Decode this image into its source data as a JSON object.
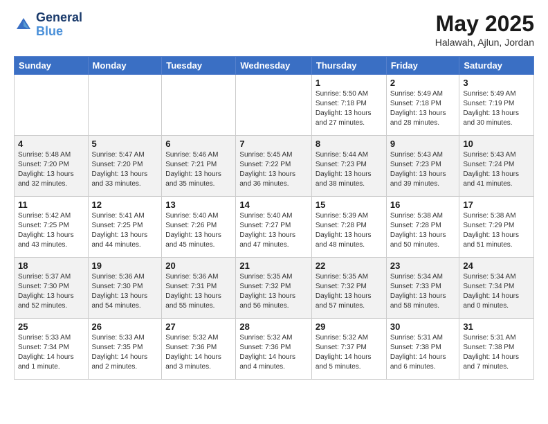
{
  "header": {
    "logo_line1": "General",
    "logo_line2": "Blue",
    "month": "May 2025",
    "location": "Halawah, Ajlun, Jordan"
  },
  "days_of_week": [
    "Sunday",
    "Monday",
    "Tuesday",
    "Wednesday",
    "Thursday",
    "Friday",
    "Saturday"
  ],
  "weeks": [
    [
      {
        "day": "",
        "info": ""
      },
      {
        "day": "",
        "info": ""
      },
      {
        "day": "",
        "info": ""
      },
      {
        "day": "",
        "info": ""
      },
      {
        "day": "1",
        "info": "Sunrise: 5:50 AM\nSunset: 7:18 PM\nDaylight: 13 hours\nand 27 minutes."
      },
      {
        "day": "2",
        "info": "Sunrise: 5:49 AM\nSunset: 7:18 PM\nDaylight: 13 hours\nand 28 minutes."
      },
      {
        "day": "3",
        "info": "Sunrise: 5:49 AM\nSunset: 7:19 PM\nDaylight: 13 hours\nand 30 minutes."
      }
    ],
    [
      {
        "day": "4",
        "info": "Sunrise: 5:48 AM\nSunset: 7:20 PM\nDaylight: 13 hours\nand 32 minutes."
      },
      {
        "day": "5",
        "info": "Sunrise: 5:47 AM\nSunset: 7:20 PM\nDaylight: 13 hours\nand 33 minutes."
      },
      {
        "day": "6",
        "info": "Sunrise: 5:46 AM\nSunset: 7:21 PM\nDaylight: 13 hours\nand 35 minutes."
      },
      {
        "day": "7",
        "info": "Sunrise: 5:45 AM\nSunset: 7:22 PM\nDaylight: 13 hours\nand 36 minutes."
      },
      {
        "day": "8",
        "info": "Sunrise: 5:44 AM\nSunset: 7:23 PM\nDaylight: 13 hours\nand 38 minutes."
      },
      {
        "day": "9",
        "info": "Sunrise: 5:43 AM\nSunset: 7:23 PM\nDaylight: 13 hours\nand 39 minutes."
      },
      {
        "day": "10",
        "info": "Sunrise: 5:43 AM\nSunset: 7:24 PM\nDaylight: 13 hours\nand 41 minutes."
      }
    ],
    [
      {
        "day": "11",
        "info": "Sunrise: 5:42 AM\nSunset: 7:25 PM\nDaylight: 13 hours\nand 43 minutes."
      },
      {
        "day": "12",
        "info": "Sunrise: 5:41 AM\nSunset: 7:25 PM\nDaylight: 13 hours\nand 44 minutes."
      },
      {
        "day": "13",
        "info": "Sunrise: 5:40 AM\nSunset: 7:26 PM\nDaylight: 13 hours\nand 45 minutes."
      },
      {
        "day": "14",
        "info": "Sunrise: 5:40 AM\nSunset: 7:27 PM\nDaylight: 13 hours\nand 47 minutes."
      },
      {
        "day": "15",
        "info": "Sunrise: 5:39 AM\nSunset: 7:28 PM\nDaylight: 13 hours\nand 48 minutes."
      },
      {
        "day": "16",
        "info": "Sunrise: 5:38 AM\nSunset: 7:28 PM\nDaylight: 13 hours\nand 50 minutes."
      },
      {
        "day": "17",
        "info": "Sunrise: 5:38 AM\nSunset: 7:29 PM\nDaylight: 13 hours\nand 51 minutes."
      }
    ],
    [
      {
        "day": "18",
        "info": "Sunrise: 5:37 AM\nSunset: 7:30 PM\nDaylight: 13 hours\nand 52 minutes."
      },
      {
        "day": "19",
        "info": "Sunrise: 5:36 AM\nSunset: 7:30 PM\nDaylight: 13 hours\nand 54 minutes."
      },
      {
        "day": "20",
        "info": "Sunrise: 5:36 AM\nSunset: 7:31 PM\nDaylight: 13 hours\nand 55 minutes."
      },
      {
        "day": "21",
        "info": "Sunrise: 5:35 AM\nSunset: 7:32 PM\nDaylight: 13 hours\nand 56 minutes."
      },
      {
        "day": "22",
        "info": "Sunrise: 5:35 AM\nSunset: 7:32 PM\nDaylight: 13 hours\nand 57 minutes."
      },
      {
        "day": "23",
        "info": "Sunrise: 5:34 AM\nSunset: 7:33 PM\nDaylight: 13 hours\nand 58 minutes."
      },
      {
        "day": "24",
        "info": "Sunrise: 5:34 AM\nSunset: 7:34 PM\nDaylight: 14 hours\nand 0 minutes."
      }
    ],
    [
      {
        "day": "25",
        "info": "Sunrise: 5:33 AM\nSunset: 7:34 PM\nDaylight: 14 hours\nand 1 minute."
      },
      {
        "day": "26",
        "info": "Sunrise: 5:33 AM\nSunset: 7:35 PM\nDaylight: 14 hours\nand 2 minutes."
      },
      {
        "day": "27",
        "info": "Sunrise: 5:32 AM\nSunset: 7:36 PM\nDaylight: 14 hours\nand 3 minutes."
      },
      {
        "day": "28",
        "info": "Sunrise: 5:32 AM\nSunset: 7:36 PM\nDaylight: 14 hours\nand 4 minutes."
      },
      {
        "day": "29",
        "info": "Sunrise: 5:32 AM\nSunset: 7:37 PM\nDaylight: 14 hours\nand 5 minutes."
      },
      {
        "day": "30",
        "info": "Sunrise: 5:31 AM\nSunset: 7:38 PM\nDaylight: 14 hours\nand 6 minutes."
      },
      {
        "day": "31",
        "info": "Sunrise: 5:31 AM\nSunset: 7:38 PM\nDaylight: 14 hours\nand 7 minutes."
      }
    ]
  ]
}
